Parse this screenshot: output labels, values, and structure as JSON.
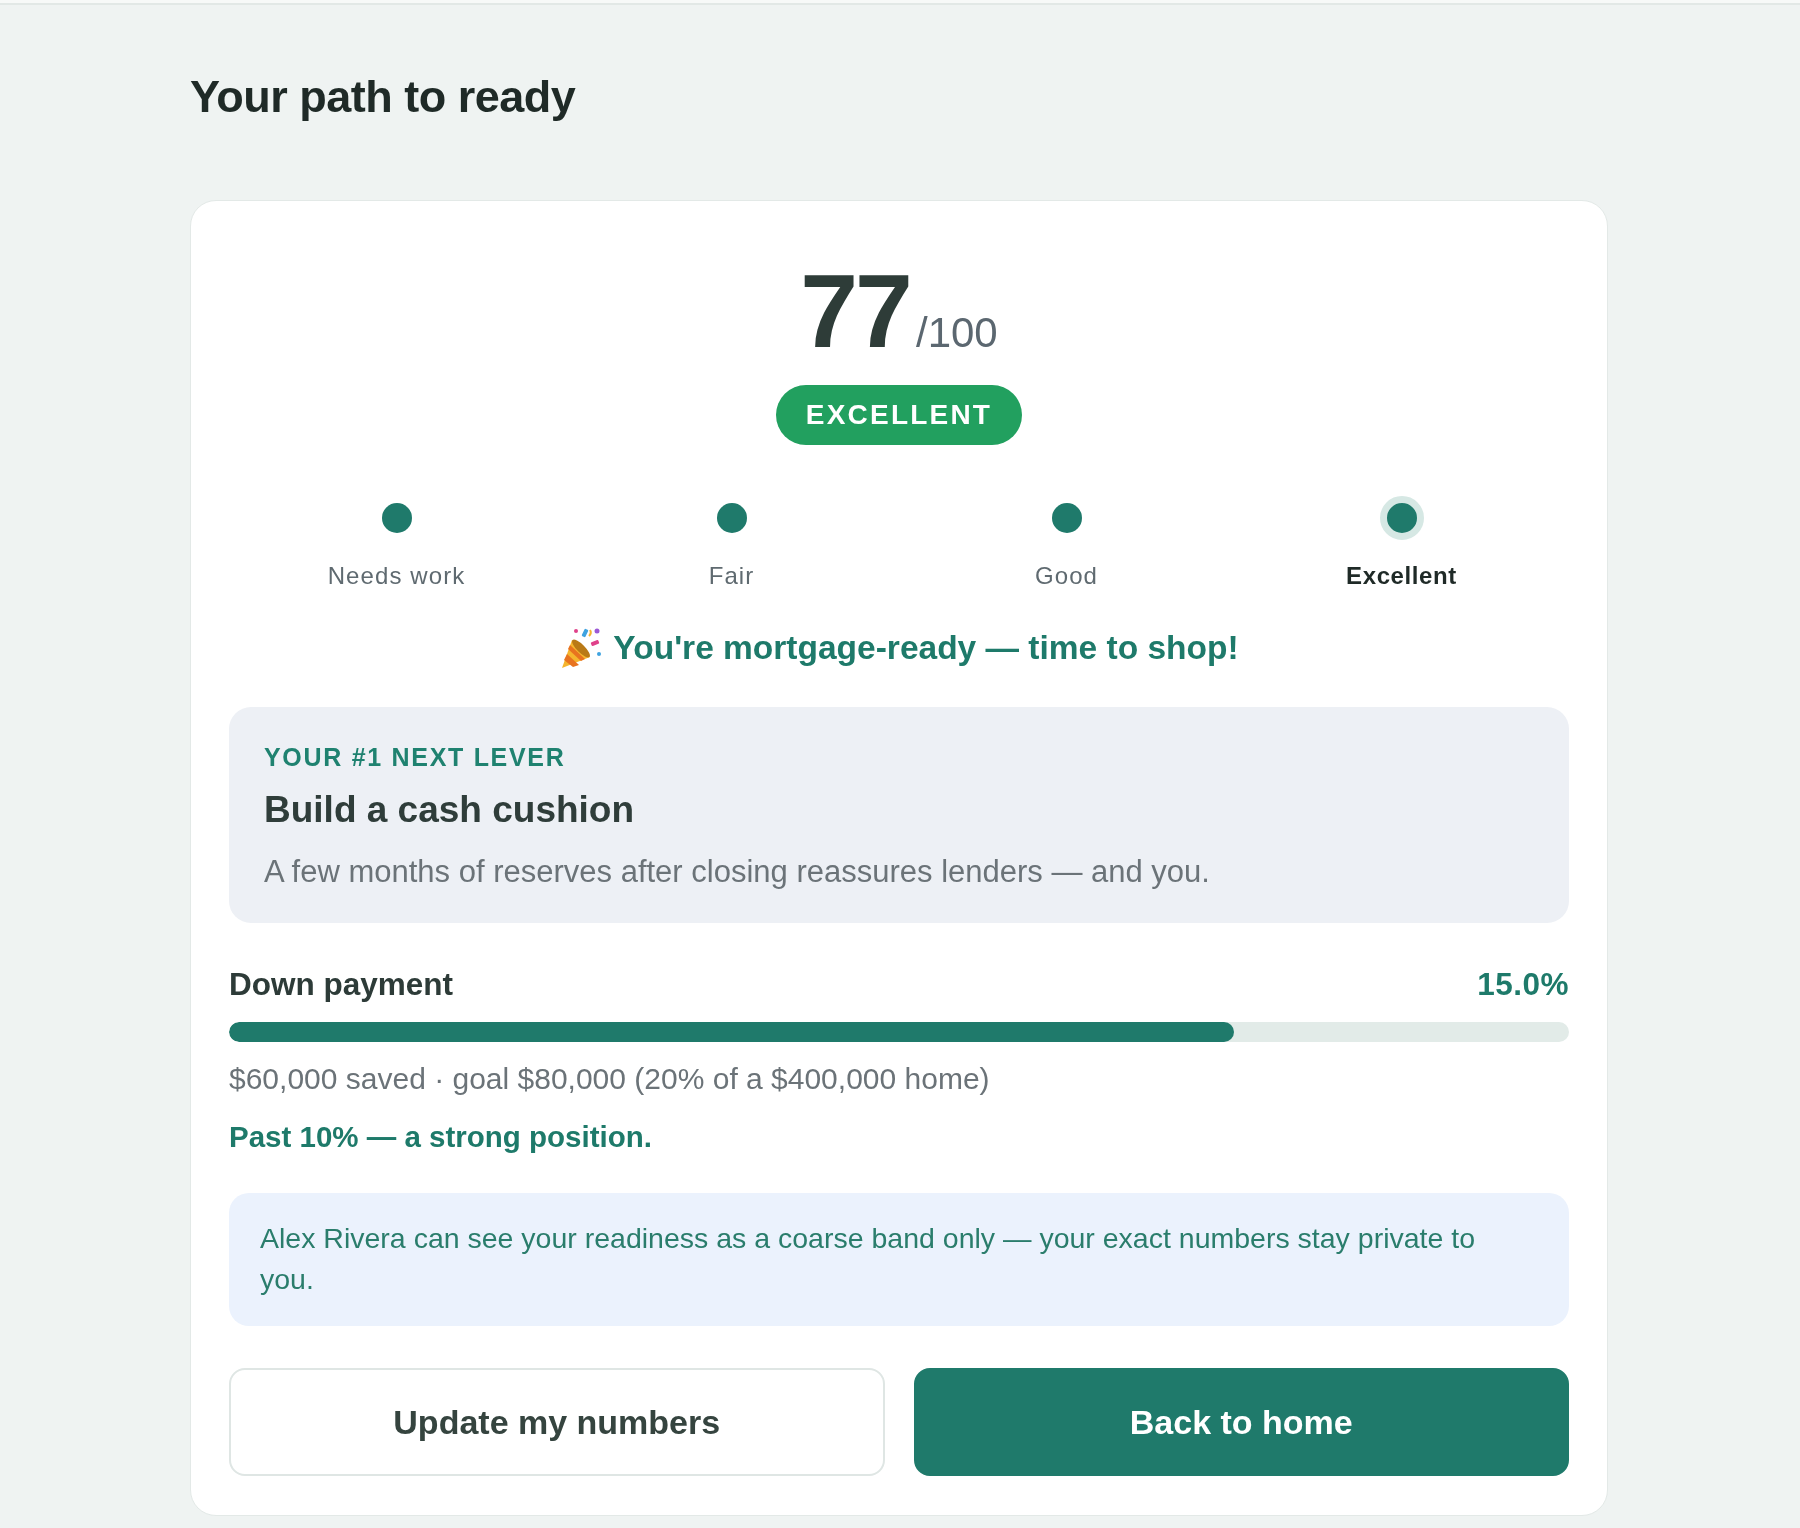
{
  "page": {
    "title": "Your path to ready"
  },
  "score": {
    "value": "77",
    "max": "/100",
    "band": "EXCELLENT"
  },
  "bands": [
    {
      "label": "Needs work",
      "selected": false
    },
    {
      "label": "Fair",
      "selected": false
    },
    {
      "label": "Good",
      "selected": false
    },
    {
      "label": "Excellent",
      "selected": true
    }
  ],
  "headline": "You're mortgage-ready — time to shop!",
  "next_lever": {
    "eyebrow": "YOUR #1 NEXT LEVER",
    "title": "Build a cash cushion",
    "description": "A few months of reserves after closing reassures lenders — and you."
  },
  "progress": {
    "label": "Down payment",
    "percent": "15.0%",
    "level": 0.75,
    "detail": "$60,000 saved · goal $80,000 (20% of a $400,000 home)",
    "note": "Past 10% — a strong position."
  },
  "privacy_note": "Alex Rivera can see your readiness as a coarse band only — your exact numbers stay private to you.",
  "buttons": [
    {
      "label": "Update my numbers",
      "kind": "secondary"
    },
    {
      "label": "Back to home",
      "kind": "primary"
    }
  ]
}
